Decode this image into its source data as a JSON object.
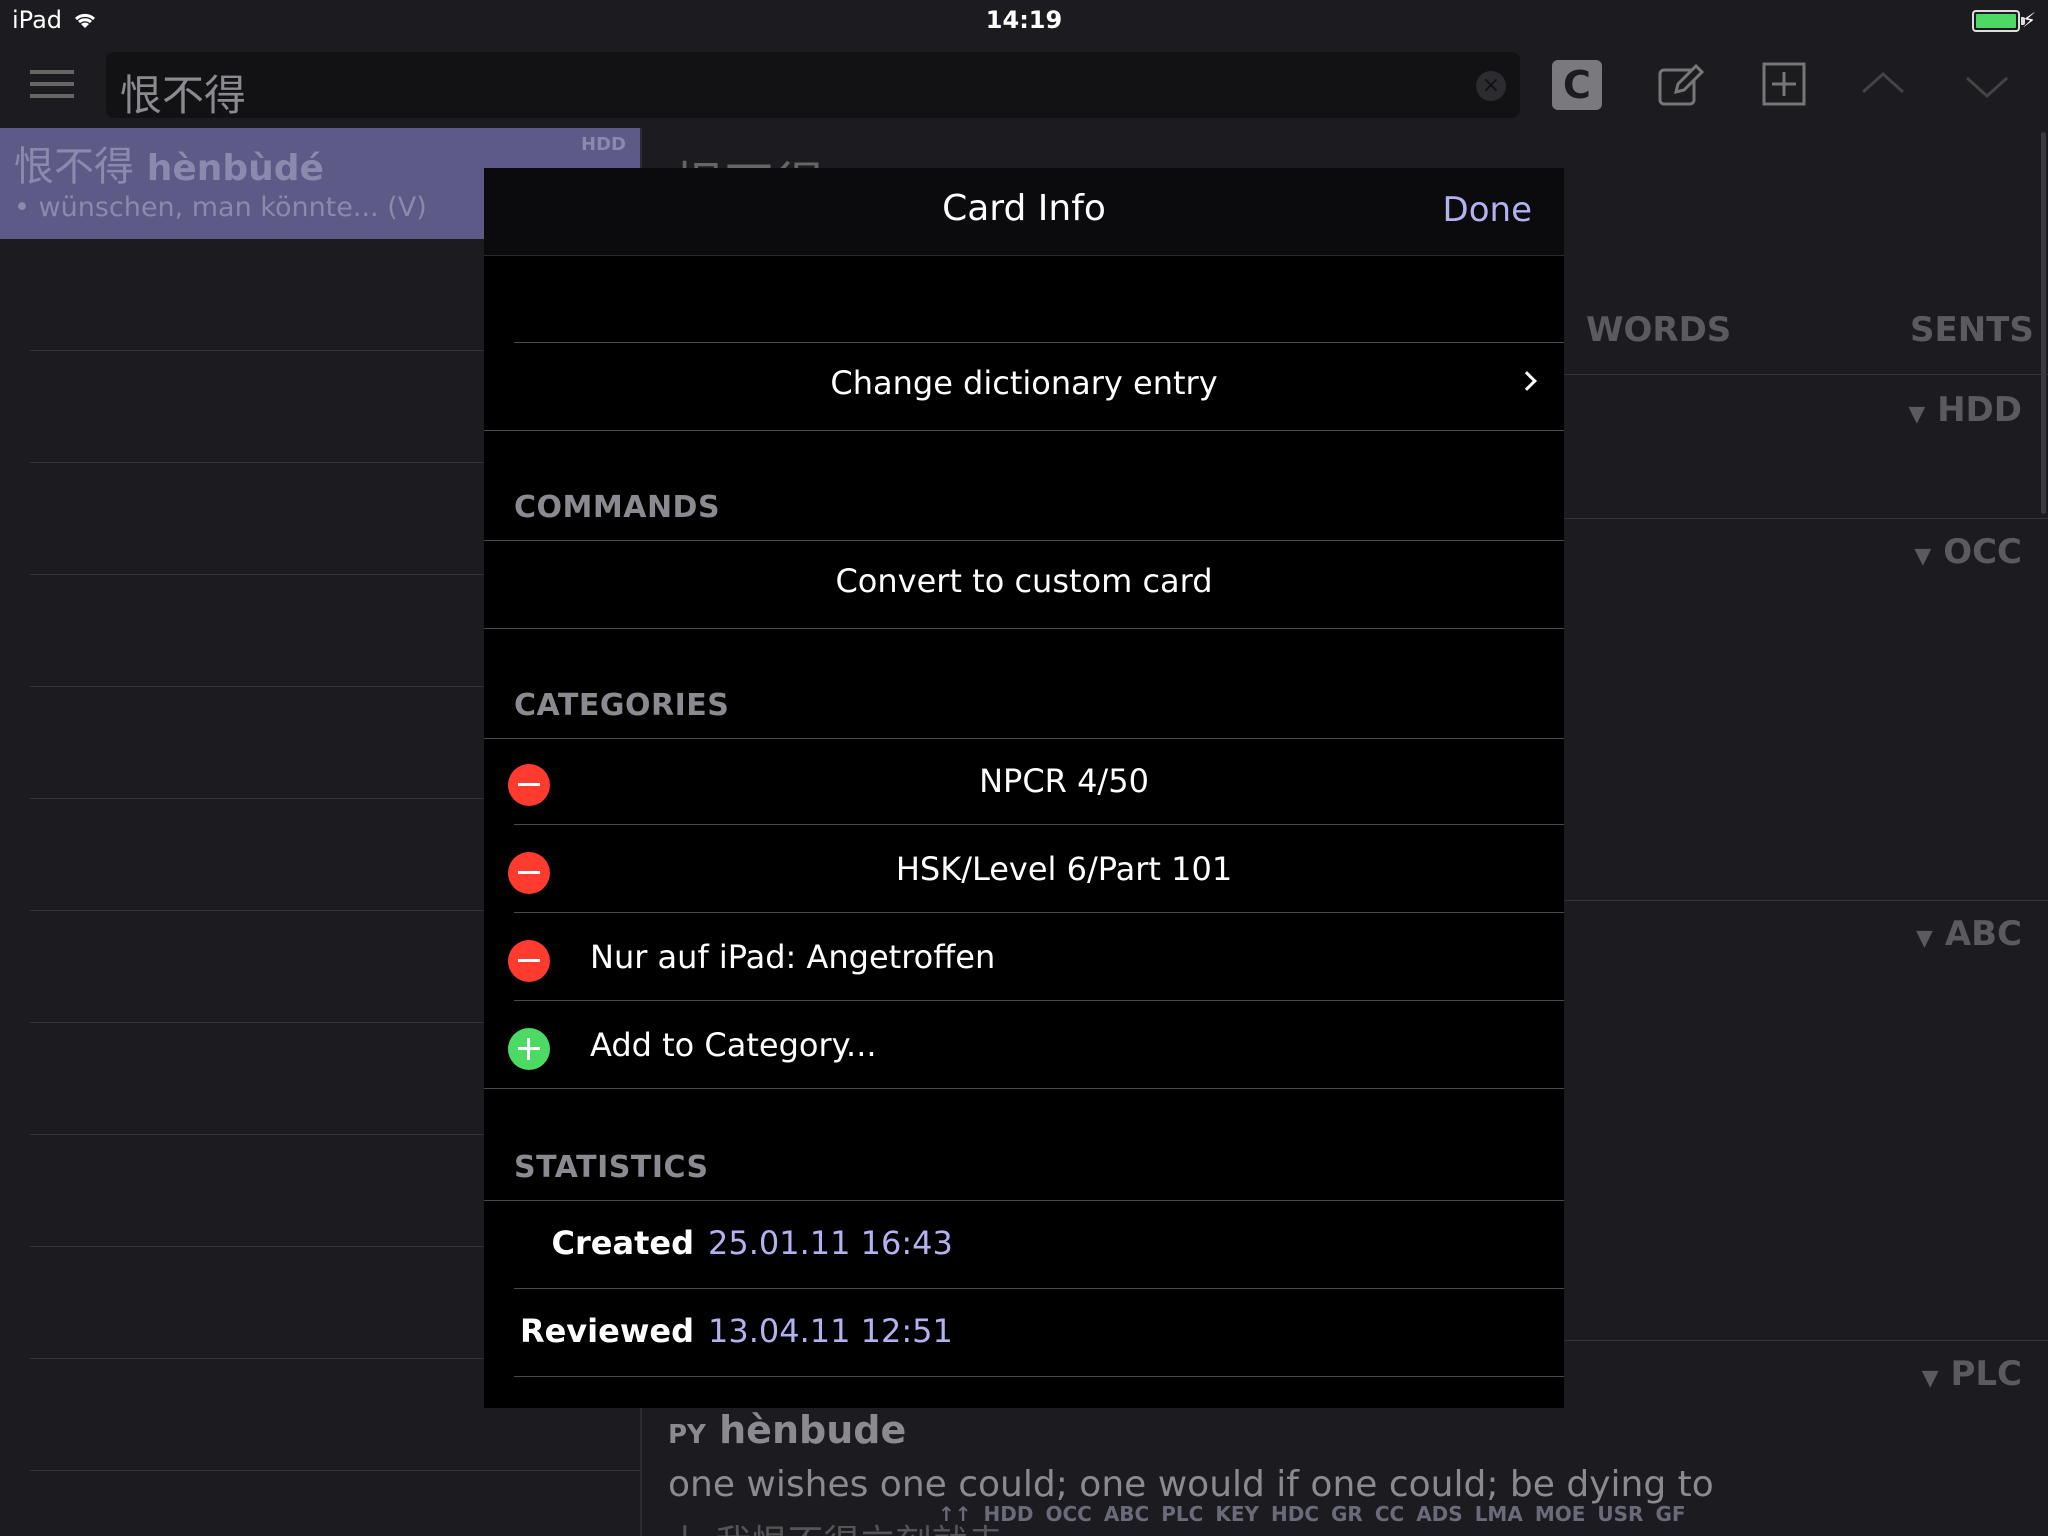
{
  "status_bar": {
    "device": "iPad",
    "time": "14:19",
    "battery_level": 1.0
  },
  "toolbar": {
    "search_value": "恨不得",
    "c_button_label": "C"
  },
  "list": {
    "selected": {
      "hanzi": "恨不得",
      "pinyin": "hènbùdé",
      "gloss": "• wünschen, man könnte... (V)",
      "tag": "HDD"
    }
  },
  "detail": {
    "title": "恨不得",
    "col_words": "WORDS",
    "col_sents": "SENTS",
    "sections": [
      "HDD",
      "OCC",
      "ABC",
      "PLC"
    ],
    "py_label": "PY",
    "py_value": "hènbude",
    "definition": "one wishes one could; one would if one could; be dying to",
    "example": "上 我恨不得立刻就走",
    "dict_tabs": [
      "↑↑",
      "HDD",
      "OCC",
      "ABC",
      "PLC",
      "KEY",
      "HDC",
      "GR",
      "CC",
      "ADS",
      "LMA",
      "MOE",
      "USR",
      "GF"
    ]
  },
  "modal": {
    "title": "Card Info",
    "done": "Done",
    "change_entry": "Change dictionary entry",
    "commands_label": "COMMANDS",
    "convert": "Convert to custom card",
    "categories_label": "CATEGORIES",
    "categories": [
      "NPCR 4/50",
      "HSK/Level 6/Part 101",
      "Nur auf iPad: Angetroffen"
    ],
    "add_category": "Add to Category...",
    "statistics_label": "STATISTICS",
    "stats": [
      {
        "label": "Created",
        "value": "25.01.11 16:43"
      },
      {
        "label": "Reviewed",
        "value": "13.04.11 12:51"
      }
    ]
  },
  "colors": {
    "accent": "#b4b1f1",
    "delete": "#ff3b30",
    "add": "#4cd964",
    "selection": "#5d5a87"
  }
}
